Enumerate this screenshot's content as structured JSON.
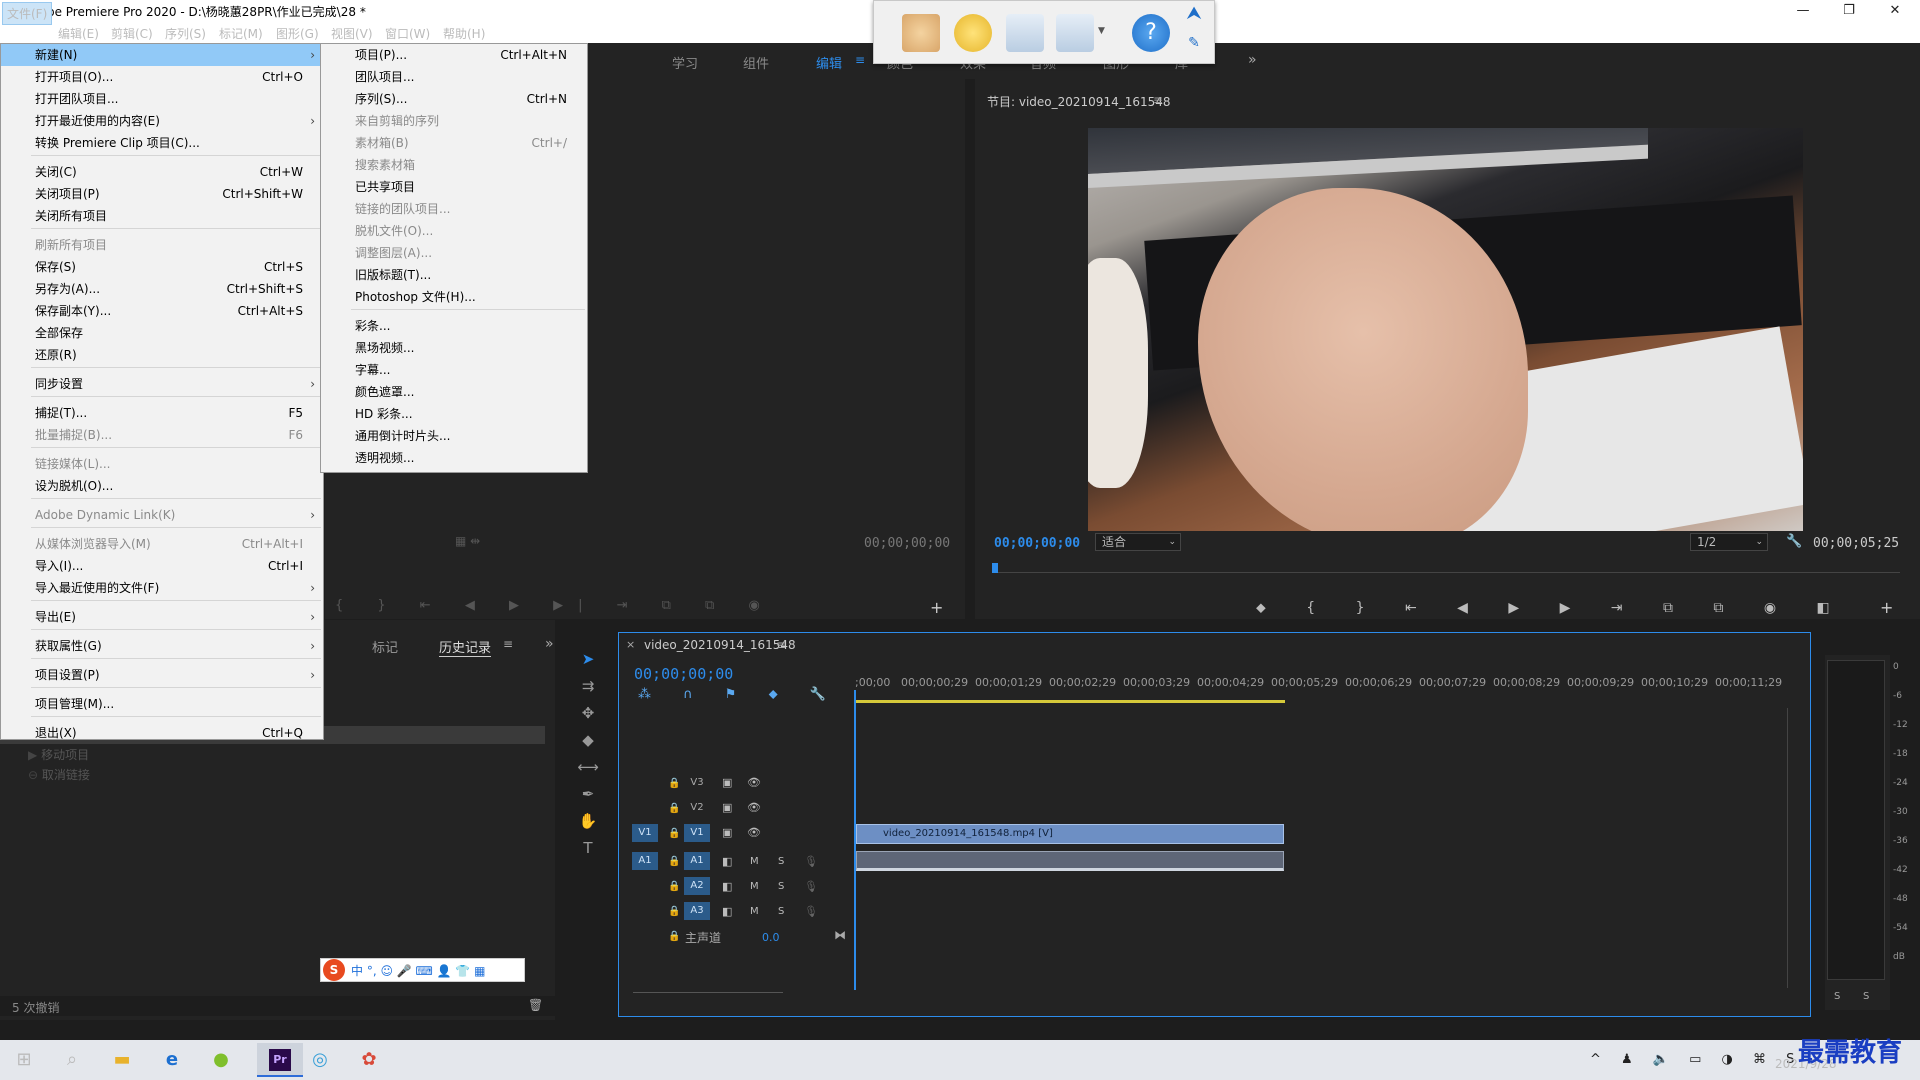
{
  "window": {
    "title": "Adobe Premiere Pro 2020 - D:\\杨晓蕙28PR\\作业已完成\\28 *",
    "app_icon_text": "Pr",
    "minimize": "—",
    "maximize": "❐",
    "close": "✕"
  },
  "menubar": [
    "文件(F)",
    "编辑(E)",
    "剪辑(C)",
    "序列(S)",
    "标记(M)",
    "图形(G)",
    "视图(V)",
    "窗口(W)",
    "帮助(H)"
  ],
  "workspaces": [
    "学习",
    "组件",
    "编辑",
    "颜色",
    "效果",
    "音频",
    "图形",
    "库"
  ],
  "file_menu": [
    {
      "label": "新建(N)",
      "arrow": true,
      "highlight": true
    },
    {
      "label": "打开项目(O)...",
      "shortcut": "Ctrl+O"
    },
    {
      "label": "打开团队项目..."
    },
    {
      "label": "打开最近使用的内容(E)",
      "arrow": true
    },
    {
      "label": "转换 Premiere Clip 项目(C)..."
    },
    {
      "label": "关闭(C)",
      "shortcut": "Ctrl+W"
    },
    {
      "label": "关闭项目(P)",
      "shortcut": "Ctrl+Shift+W"
    },
    {
      "label": "关闭所有项目"
    },
    {
      "label": "刷新所有项目",
      "disabled": true
    },
    {
      "label": "保存(S)",
      "shortcut": "Ctrl+S"
    },
    {
      "label": "另存为(A)...",
      "shortcut": "Ctrl+Shift+S"
    },
    {
      "label": "保存副本(Y)...",
      "shortcut": "Ctrl+Alt+S"
    },
    {
      "label": "全部保存"
    },
    {
      "label": "还原(R)"
    },
    {
      "label": "同步设置",
      "arrow": true
    },
    {
      "label": "捕捉(T)...",
      "shortcut": "F5"
    },
    {
      "label": "批量捕捉(B)...",
      "shortcut": "F6",
      "disabled": true
    },
    {
      "label": "链接媒体(L)...",
      "disabled": true
    },
    {
      "label": "设为脱机(O)..."
    },
    {
      "label": "Adobe Dynamic Link(K)",
      "arrow": true,
      "disabled": true
    },
    {
      "label": "从媒体浏览器导入(M)",
      "shortcut": "Ctrl+Alt+I",
      "disabled": true
    },
    {
      "label": "导入(I)...",
      "shortcut": "Ctrl+I"
    },
    {
      "label": "导入最近使用的文件(F)",
      "arrow": true
    },
    {
      "label": "导出(E)",
      "arrow": true
    },
    {
      "label": "获取属性(G)",
      "arrow": true
    },
    {
      "label": "项目设置(P)",
      "arrow": true
    },
    {
      "label": "项目管理(M)..."
    },
    {
      "label": "退出(X)",
      "shortcut": "Ctrl+Q"
    }
  ],
  "new_menu": [
    {
      "label": "项目(P)...",
      "shortcut": "Ctrl+Alt+N"
    },
    {
      "label": "团队项目..."
    },
    {
      "label": "序列(S)...",
      "shortcut": "Ctrl+N"
    },
    {
      "label": "来自剪辑的序列",
      "disabled": true
    },
    {
      "label": "素材箱(B)",
      "shortcut": "Ctrl+/",
      "disabled": true
    },
    {
      "label": "搜索素材箱",
      "disabled": true
    },
    {
      "label": "已共享项目"
    },
    {
      "label": "链接的团队项目...",
      "disabled": true
    },
    {
      "label": "脱机文件(O)...",
      "disabled": true
    },
    {
      "label": "调整图层(A)...",
      "disabled": true
    },
    {
      "label": "旧版标题(T)..."
    },
    {
      "label": "Photoshop 文件(H)..."
    },
    {
      "label": "彩条..."
    },
    {
      "label": "黑场视频..."
    },
    {
      "label": "字幕..."
    },
    {
      "label": "颜色遮罩..."
    },
    {
      "label": "HD 彩条..."
    },
    {
      "label": "通用倒计时片头..."
    },
    {
      "label": "透明视频..."
    }
  ],
  "source": {
    "timecode": "00;00;00;00"
  },
  "program": {
    "title": "节目: video_20210914_161548",
    "timecode": "00;00;00;00",
    "fit": "适合",
    "resolution": "1/2",
    "duration": "00;00;05;25"
  },
  "history": {
    "tabs": [
      "标记",
      "历史记录"
    ],
    "items": [
      "移动项目",
      "取消链接"
    ],
    "footer": "5 次撤销"
  },
  "timeline": {
    "tab": "video_20210914_161548",
    "timecode": "00;00;00;00",
    "ruler": [
      ";00;00",
      "00;00;00;29",
      "00;00;01;29",
      "00;00;02;29",
      "00;00;03;29",
      "00;00;04;29",
      "00;00;05;29",
      "00;00;06;29",
      "00;00;07;29",
      "00;00;08;29",
      "00;00;09;29",
      "00;00;10;29",
      "00;00;11;29"
    ],
    "video_tracks": [
      "V3",
      "V2",
      "V1"
    ],
    "audio_tracks": [
      "A1",
      "A2",
      "A3"
    ],
    "src_v": "V1",
    "src_a": "A1",
    "master": "主声道",
    "master_value": "0.0",
    "clip_label": "video_20210914_161548.mp4 [V]",
    "mute": "M",
    "solo": "S"
  },
  "meter": {
    "labels": [
      "0",
      "-6",
      "-12",
      "-18",
      "-24",
      "-30",
      "-36",
      "-42",
      "-48",
      "-54",
      "dB"
    ],
    "solo": [
      "S",
      "S"
    ]
  },
  "ime": {
    "label": "中 °, ☺ 🎤 ⌨ 👤 👕 ▦"
  },
  "taskbar": {
    "date": "2021/9/28"
  },
  "watermark": "最需教育",
  "colors": {
    "accent": "#2d8ceb",
    "menu_highlight": "#91c9f7",
    "workarea": "#d5c93a"
  }
}
